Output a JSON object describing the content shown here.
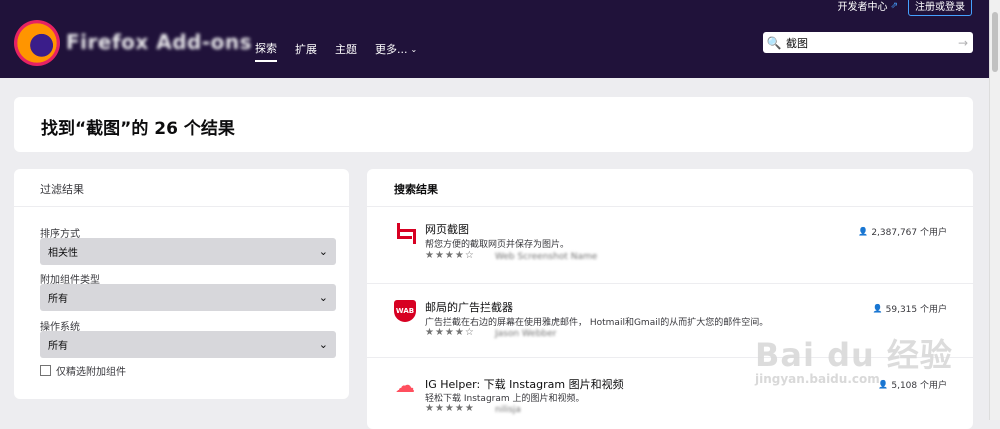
{
  "header": {
    "brand": "Firefox Add-ons",
    "dev_hub": "开发者中心",
    "login": "注册或登录",
    "nav": [
      "探索",
      "扩展",
      "主题",
      "更多..."
    ],
    "search_value": "截图"
  },
  "heading": "找到“截图”的 26 个结果",
  "filter": {
    "title": "过滤结果",
    "sort_label": "排序方式",
    "sort_value": "相关性",
    "type_label": "附加组件类型",
    "type_value": "所有",
    "os_label": "操作系统",
    "os_value": "所有",
    "recommended_label": "仅精选附加组件"
  },
  "results": {
    "title": "搜索结果",
    "items": [
      {
        "name": "网页截图",
        "desc": "帮您方便的截取网页并保存为图片。",
        "stars": "★★★★☆",
        "rating": 3.5,
        "author": "Web Screenshot Name",
        "users": "2,387,767 个用户",
        "icon": "crop-icon"
      },
      {
        "name": "邮局的广告拦截器",
        "desc": "广告拦截在右边的屏幕在使用雅虎邮件， Hotmail和Gmail的从而扩大您的邮件空间。",
        "stars": "★★★★☆",
        "rating": 4,
        "author": "Jason Webber",
        "users": "59,315 个用户",
        "icon": "shield-icon"
      },
      {
        "name": "IG Helper: 下载 Instagram 图片和视频",
        "desc": "轻松下载 Instagram 上的图片和视频。",
        "stars": "★★★★★",
        "rating": 4.5,
        "author": "nilisja",
        "users": "5,108 个用户",
        "icon": "cloud-download-icon"
      }
    ]
  },
  "watermark": {
    "big": "Bai du 经验",
    "small": "jingyan.baidu.com"
  }
}
